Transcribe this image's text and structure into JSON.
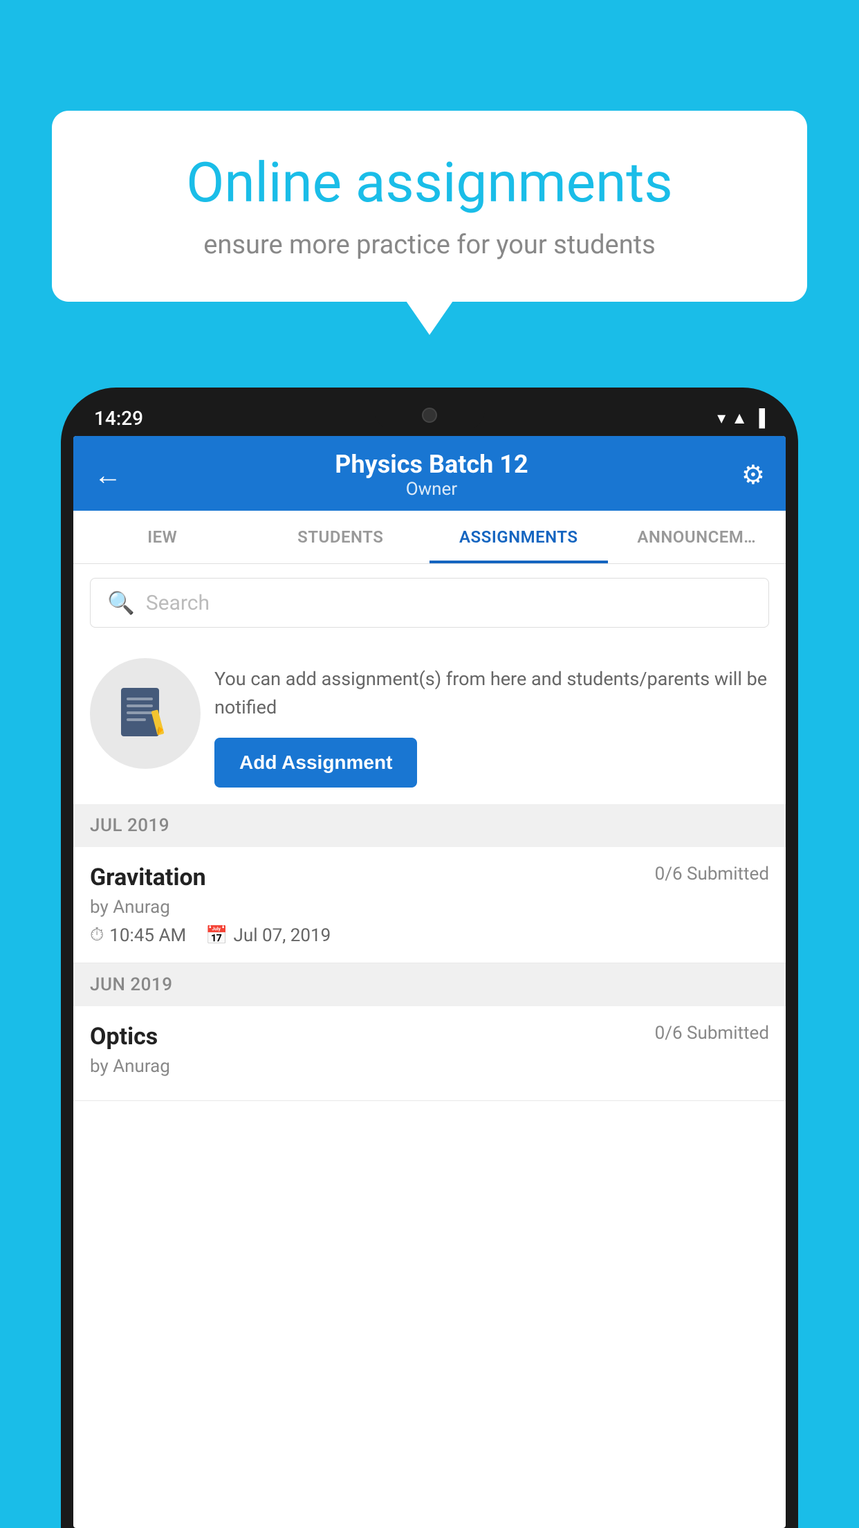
{
  "background_color": "#1ABDE8",
  "speech_bubble": {
    "title": "Online assignments",
    "subtitle": "ensure more practice for your students"
  },
  "phone": {
    "status_bar": {
      "time": "14:29"
    },
    "header": {
      "title": "Physics Batch 12",
      "subtitle": "Owner",
      "back_label": "←",
      "gear_label": "⚙"
    },
    "tabs": [
      {
        "label": "IEW",
        "active": false
      },
      {
        "label": "STUDENTS",
        "active": false
      },
      {
        "label": "ASSIGNMENTS",
        "active": true
      },
      {
        "label": "ANNOUNCEM…",
        "active": false
      }
    ],
    "search": {
      "placeholder": "Search"
    },
    "info_card": {
      "description": "You can add assignment(s) from here and students/parents will be notified",
      "button_label": "Add Assignment"
    },
    "sections": [
      {
        "label": "JUL 2019",
        "assignments": [
          {
            "name": "Gravitation",
            "submitted": "0/6 Submitted",
            "by": "by Anurag",
            "time": "10:45 AM",
            "date": "Jul 07, 2019"
          }
        ]
      },
      {
        "label": "JUN 2019",
        "assignments": [
          {
            "name": "Optics",
            "submitted": "0/6 Submitted",
            "by": "by Anurag",
            "time": "",
            "date": ""
          }
        ]
      }
    ]
  }
}
